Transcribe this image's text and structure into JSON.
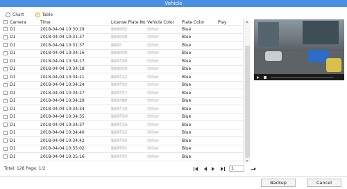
{
  "window": {
    "title": "Vehicle"
  },
  "view": {
    "options": [
      "Chart",
      "Table"
    ],
    "selected": "Table"
  },
  "table": {
    "headers": {
      "camera": "Camera",
      "time": "Time",
      "plate": "License Plate No.",
      "vehicle_color": "Vehicle Color",
      "plate_color": "Plate Color",
      "play": "Play"
    },
    "rows": [
      {
        "camera": "D1",
        "time": "2018-04-04 10:30:29",
        "plate": "BA9002",
        "vehicle_color": "Other",
        "plate_color": "Blue"
      },
      {
        "camera": "D1",
        "time": "2018-04-04 10:31:37",
        "plate": "BA9008",
        "vehicle_color": "Other",
        "plate_color": "Blue"
      },
      {
        "camera": "D1",
        "time": "2018-04-04 10:31:37",
        "plate": "BA9?",
        "vehicle_color": "Other",
        "plate_color": "Blue"
      },
      {
        "camera": "D1",
        "time": "2018-04-04 10:34:16",
        "plate": "BA9009",
        "vehicle_color": "Other",
        "plate_color": "Blue"
      },
      {
        "camera": "D1",
        "time": "2018-04-04 10:34:17",
        "plate": "BA9T09",
        "vehicle_color": "Other",
        "plate_color": "Blue"
      },
      {
        "camera": "D1",
        "time": "2018-04-04 10:34:18",
        "plate": "BA9009",
        "vehicle_color": "Other",
        "plate_color": "Blue"
      },
      {
        "camera": "D1",
        "time": "2018-04-04 10:34:21",
        "plate": "BA9T22",
        "vehicle_color": "Other",
        "plate_color": "Blue"
      },
      {
        "camera": "D1",
        "time": "2018-04-04 10:34:24",
        "plate": "BA9T50",
        "vehicle_color": "Other",
        "plate_color": "Blue"
      },
      {
        "camera": "D1",
        "time": "2018-04-04 10:34:27",
        "plate": "BA9T57",
        "vehicle_color": "Other",
        "plate_color": "Blue"
      },
      {
        "camera": "D1",
        "time": "2018-04-04 10:34:29",
        "plate": "BA9?88",
        "vehicle_color": "Other",
        "plate_color": "Blue"
      },
      {
        "camera": "D1",
        "time": "2018-04-04 10:34:34",
        "plate": "BA9T19",
        "vehicle_color": "Other",
        "plate_color": "Blue"
      },
      {
        "camera": "D1",
        "time": "2018-04-04 10:34:35",
        "plate": "BA9T5H",
        "vehicle_color": "Other",
        "plate_color": "Blue"
      },
      {
        "camera": "D1",
        "time": "2018-04-04 10:34:37",
        "plate": "BA9T2A",
        "vehicle_color": "Other",
        "plate_color": "Blue"
      },
      {
        "camera": "D1",
        "time": "2018-04-04 10:34:40",
        "plate": "BA9T22",
        "vehicle_color": "Other",
        "plate_color": "Blue"
      },
      {
        "camera": "D1",
        "time": "2018-04-04 10:34:42",
        "plate": "BA9T59",
        "vehicle_color": "Other",
        "plate_color": "Blue"
      },
      {
        "camera": "D1",
        "time": "2018-04-04 10:35:02",
        "plate": "BA9T01",
        "vehicle_color": "Other",
        "plate_color": "Blue"
      },
      {
        "camera": "D1",
        "time": "2018-04-04 10:35:16",
        "plate": "BA9T03",
        "vehicle_color": "Other",
        "plate_color": "Blue"
      }
    ]
  },
  "footer": {
    "total": "Total: 128  Page: 1/2",
    "page_input": "1"
  },
  "buttons": {
    "backup": "Backup",
    "cancel": "Cancel"
  },
  "colors": {
    "accent": "#4a90e2",
    "radio_selected": "#f5a623"
  }
}
